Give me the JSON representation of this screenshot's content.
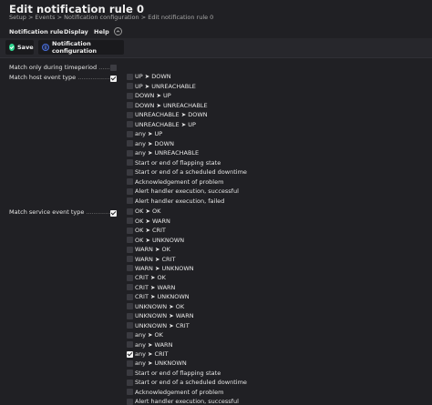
{
  "page": {
    "title": "Edit notification rule 0",
    "breadcrumb": [
      "Setup",
      "Events",
      "Notification configuration",
      "Edit notification rule 0"
    ],
    "breadcrumb_sep": ">"
  },
  "menu": {
    "items": [
      "Notification rule",
      "Display",
      "Help"
    ]
  },
  "toolbar": {
    "save_label": "Save",
    "config_label": "Notification configuration"
  },
  "form": {
    "timeperiod": {
      "label": "Match only during timeperiod",
      "checked": false
    },
    "host_event": {
      "label": "Match host event type",
      "checked": true,
      "options": [
        {
          "label": "UP ➤ DOWN",
          "checked": false
        },
        {
          "label": "UP ➤ UNREACHABLE",
          "checked": false
        },
        {
          "label": "DOWN ➤ UP",
          "checked": false
        },
        {
          "label": "DOWN ➤ UNREACHABLE",
          "checked": false
        },
        {
          "label": "UNREACHABLE ➤ DOWN",
          "checked": false
        },
        {
          "label": "UNREACHABLE ➤ UP",
          "checked": false
        },
        {
          "label": "any ➤ UP",
          "checked": false
        },
        {
          "label": "any ➤ DOWN",
          "checked": false
        },
        {
          "label": "any ➤ UNREACHABLE",
          "checked": false
        },
        {
          "label": "Start or end of flapping state",
          "checked": false
        },
        {
          "label": "Start or end of a scheduled downtime",
          "checked": false
        },
        {
          "label": "Acknowledgement of problem",
          "checked": false
        },
        {
          "label": "Alert handler execution, successful",
          "checked": false
        },
        {
          "label": "Alert handler execution, failed",
          "checked": false
        }
      ]
    },
    "service_event": {
      "label": "Match service event type",
      "checked": true,
      "options": [
        {
          "label": "OK ➤ OK",
          "checked": false
        },
        {
          "label": "OK ➤ WARN",
          "checked": false
        },
        {
          "label": "OK ➤ CRIT",
          "checked": false
        },
        {
          "label": "OK ➤ UNKNOWN",
          "checked": false
        },
        {
          "label": "WARN ➤ OK",
          "checked": false
        },
        {
          "label": "WARN ➤ CRIT",
          "checked": false
        },
        {
          "label": "WARN ➤ UNKNOWN",
          "checked": false
        },
        {
          "label": "CRIT ➤ OK",
          "checked": false
        },
        {
          "label": "CRIT ➤ WARN",
          "checked": false
        },
        {
          "label": "CRIT ➤ UNKNOWN",
          "checked": false
        },
        {
          "label": "UNKNOWN ➤ OK",
          "checked": false
        },
        {
          "label": "UNKNOWN ➤ WARN",
          "checked": false
        },
        {
          "label": "UNKNOWN ➤ CRIT",
          "checked": false
        },
        {
          "label": "any ➤ OK",
          "checked": false
        },
        {
          "label": "any ➤ WARN",
          "checked": false
        },
        {
          "label": "any ➤ CRIT",
          "checked": true
        },
        {
          "label": "any ➤ UNKNOWN",
          "checked": false
        },
        {
          "label": "Start or end of flapping state",
          "checked": false
        },
        {
          "label": "Start or end of a scheduled downtime",
          "checked": false
        },
        {
          "label": "Acknowledgement of problem",
          "checked": false
        },
        {
          "label": "Alert handler execution, successful",
          "checked": false
        }
      ]
    }
  },
  "colors": {
    "background": "#202024",
    "save_icon": "#2fd58e",
    "info_icon": "#4a6ed8"
  },
  "icons": {
    "save": "check-circle-icon",
    "config": "info-icon",
    "menu_toggle": "chevron-up-icon"
  }
}
